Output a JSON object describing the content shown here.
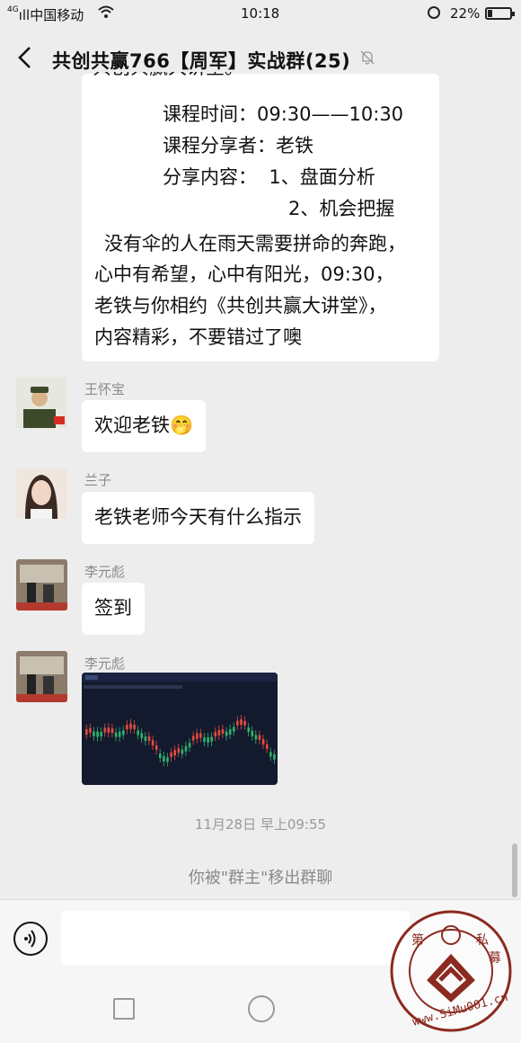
{
  "status_bar": {
    "signal": "4G",
    "carrier": "中国移动",
    "time": "10:18",
    "battery": "22%",
    "battery_level": 0.22
  },
  "header": {
    "title": "共创共赢766【周军】实战群(25)"
  },
  "messages": {
    "announcement": {
      "lines": [
        "课程时间：09:30——10:30",
        "课程分享者：老铁",
        "分享内容：  1、盘面分析",
        "2、机会把握",
        "没有伞的人在雨天需要拼命的奔跑，",
        "心中有希望，心中有阳光，09:30，",
        "老铁与你相约《共创共赢大讲堂》，",
        "内容精彩，不要错过了噢"
      ]
    },
    "items": [
      {
        "sender": "王怀宝",
        "text": "欢迎老铁",
        "emoji": "🤭"
      },
      {
        "sender": "兰子",
        "text": "老铁老师今天有什么指示"
      },
      {
        "sender": "李元彪",
        "text": "签到"
      },
      {
        "sender": "李元彪",
        "image": "stock-chart-thumbnail"
      }
    ]
  },
  "timestamp": "11月28日 早上09:55",
  "system_notice": "你被\"群主\"移出群聊",
  "input": {
    "placeholder": ""
  },
  "watermark": {
    "text": "私募排排网 www.SiMu001.cn"
  },
  "colors": {
    "background": "#ededed",
    "bubble": "#ffffff",
    "chart_bg": "#141a2e",
    "candle_up": "#e84a3f",
    "candle_down": "#2db36b"
  }
}
